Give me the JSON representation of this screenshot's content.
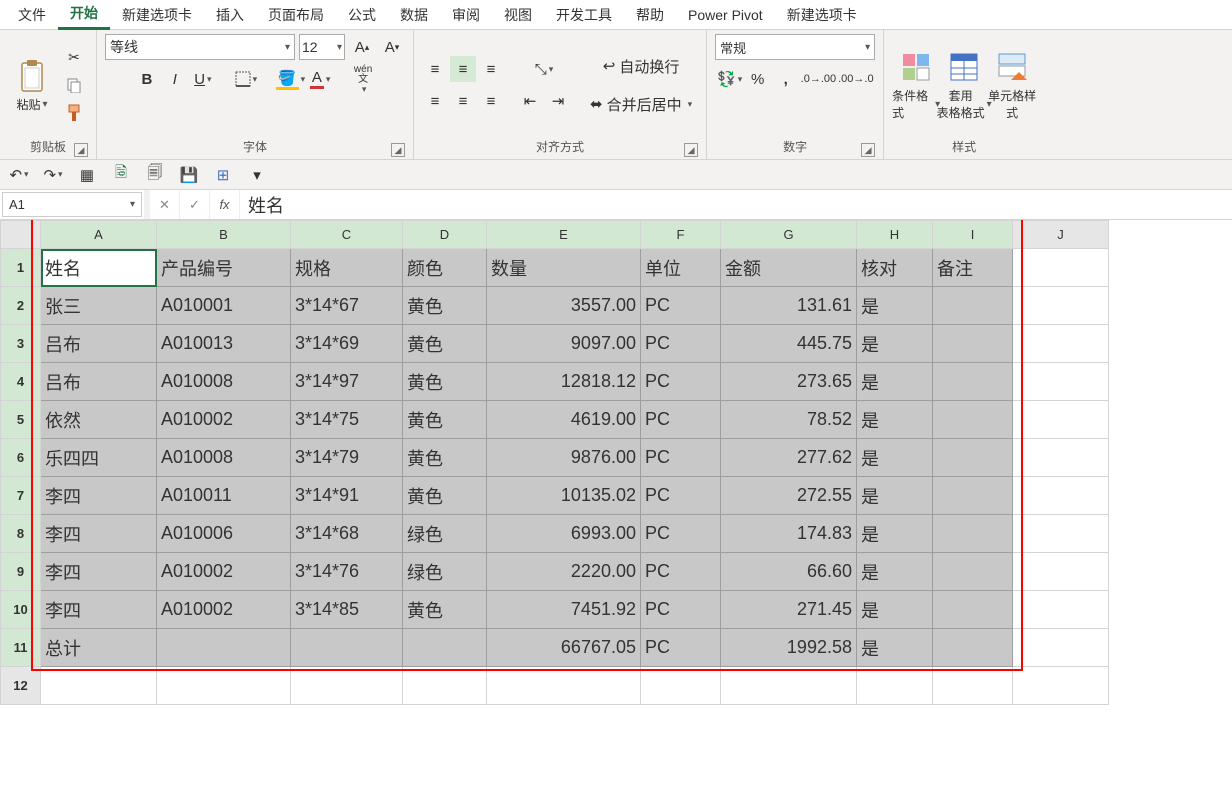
{
  "menu": {
    "tabs": [
      "文件",
      "开始",
      "新建选项卡",
      "插入",
      "页面布局",
      "公式",
      "数据",
      "审阅",
      "视图",
      "开发工具",
      "帮助",
      "Power Pivot",
      "新建选项卡"
    ],
    "active_index": 1
  },
  "ribbon": {
    "clipboard": {
      "paste": "粘贴",
      "label": "剪贴板"
    },
    "font": {
      "name": "等线",
      "size": "12",
      "bold": "B",
      "italic": "I",
      "underline": "U",
      "ruby": "wén",
      "ruby2": "文",
      "label": "字体"
    },
    "alignment": {
      "wrap": "自动换行",
      "merge": "合并后居中",
      "label": "对齐方式"
    },
    "number": {
      "format": "常规",
      "label": "数字"
    },
    "styles": {
      "cond": "条件格式",
      "table": "套用\n表格格式",
      "cell": "单元格样式",
      "label": "样式"
    }
  },
  "name_box": "A1",
  "formula_value": "姓名",
  "columns": [
    "A",
    "B",
    "C",
    "D",
    "E",
    "F",
    "G",
    "H",
    "I",
    "J"
  ],
  "selected_cols": 9,
  "selected_rows": 11,
  "headers": [
    "姓名",
    "产品编号",
    "规格",
    "颜色",
    "数量",
    "单位",
    "金额",
    "核对",
    "备注"
  ],
  "rows": [
    [
      "张三",
      "A010001",
      "3*14*67",
      "黄色",
      "3557.00",
      "PC",
      "131.61",
      "是",
      ""
    ],
    [
      "吕布",
      "A010013",
      "3*14*69",
      "黄色",
      "9097.00",
      "PC",
      "445.75",
      "是",
      ""
    ],
    [
      "吕布",
      "A010008",
      "3*14*97",
      "黄色",
      "12818.12",
      "PC",
      "273.65",
      "是",
      ""
    ],
    [
      "依然",
      "A010002",
      "3*14*75",
      "黄色",
      "4619.00",
      "PC",
      "78.52",
      "是",
      ""
    ],
    [
      "乐四四",
      "A010008",
      "3*14*79",
      "黄色",
      "9876.00",
      "PC",
      "277.62",
      "是",
      ""
    ],
    [
      "李四",
      "A010011",
      "3*14*91",
      "黄色",
      "10135.02",
      "PC",
      "272.55",
      "是",
      ""
    ],
    [
      "李四",
      "A010006",
      "3*14*68",
      "绿色",
      "6993.00",
      "PC",
      "174.83",
      "是",
      ""
    ],
    [
      "李四",
      "A010002",
      "3*14*76",
      "绿色",
      "2220.00",
      "PC",
      "66.60",
      "是",
      ""
    ],
    [
      "李四",
      "A010002",
      "3*14*85",
      "黄色",
      "7451.92",
      "PC",
      "271.45",
      "是",
      ""
    ],
    [
      "总计",
      "",
      "",
      "",
      "66767.05",
      "PC",
      "1992.58",
      "是",
      ""
    ]
  ],
  "numeric_cols": [
    4,
    6
  ]
}
